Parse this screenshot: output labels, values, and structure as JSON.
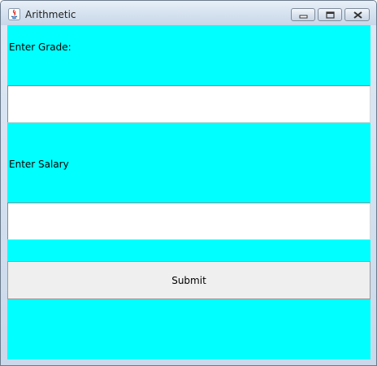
{
  "window": {
    "title": "Arithmetic",
    "icon": "java-icon",
    "controls": [
      "minimize",
      "maximize",
      "close"
    ]
  },
  "form": {
    "grade_label": "Enter Grade:",
    "grade_value": "",
    "salary_label": "Enter Salary",
    "salary_value": "",
    "submit_label": "Submit"
  },
  "colors": {
    "panel_background": "#00ffff",
    "button_background": "#efefef",
    "field_background": "#ffffff"
  }
}
